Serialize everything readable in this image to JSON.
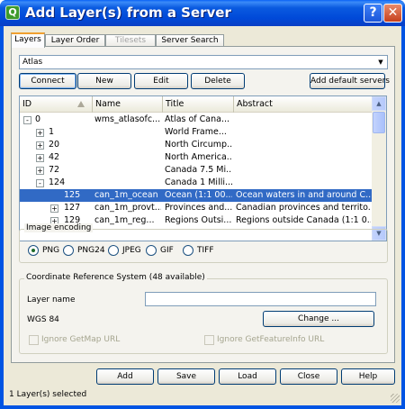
{
  "window": {
    "title": "Add Layer(s) from a Server",
    "help_button": "?",
    "close_button": "✕"
  },
  "tabs": [
    {
      "label": "Layers",
      "active": true
    },
    {
      "label": "Layer Order",
      "active": false
    },
    {
      "label": "Tilesets",
      "active": false,
      "disabled": true
    },
    {
      "label": "Server Search",
      "active": false
    }
  ],
  "server": {
    "selected": "Atlas"
  },
  "buttons": {
    "connect": "Connect",
    "new": "New",
    "edit": "Edit",
    "delete": "Delete",
    "add_default_servers": "Add default servers"
  },
  "layer_table": {
    "columns": [
      "ID",
      "Name",
      "Title",
      "Abstract"
    ],
    "rows": [
      {
        "expander": "-",
        "id": "0",
        "name": "wms_atlasofc...",
        "title": "Atlas of Cana...",
        "abstract": ""
      },
      {
        "expander": "+",
        "id": "1",
        "name": "",
        "title": "World Frame...",
        "abstract": ""
      },
      {
        "expander": "+",
        "id": "20",
        "name": "",
        "title": "North Circump...",
        "abstract": ""
      },
      {
        "expander": "+",
        "id": "42",
        "name": "",
        "title": "North America...",
        "abstract": ""
      },
      {
        "expander": "+",
        "id": "72",
        "name": "",
        "title": "Canada 7.5 Mi...",
        "abstract": ""
      },
      {
        "expander": "-",
        "id": "124",
        "name": "",
        "title": "Canada 1 Milli...",
        "abstract": ""
      },
      {
        "expander": "",
        "id": "125",
        "name": "can_1m_ocean",
        "title": "Ocean (1:1 00...",
        "abstract": "Ocean waters in and around C...",
        "selected": true
      },
      {
        "expander": "+",
        "id": "127",
        "name": "can_1m_provt...",
        "title": "Provinces and...",
        "abstract": "Canadian provinces and territo..."
      },
      {
        "expander": "+",
        "id": "129",
        "name": "can_1m_reg...",
        "title": "Regions Outsi...",
        "abstract": "Regions outside Canada (1:1 0..."
      }
    ]
  },
  "image_encoding": {
    "label": "Image encoding",
    "options": [
      "PNG",
      "PNG24",
      "JPEG",
      "GIF",
      "TIFF"
    ],
    "selected": "PNG"
  },
  "crs": {
    "group_label": "Coordinate Reference System (48 available)",
    "layer_name_label": "Layer name",
    "layer_name_value": "",
    "current_crs": "WGS 84",
    "change_button": "Change ..."
  },
  "options": {
    "ignore_getmap": "Ignore GetMap URL",
    "ignore_getfeatureinfo": "Ignore GetFeatureInfo URL"
  },
  "footer_buttons": {
    "add": "Add",
    "save": "Save",
    "load": "Load",
    "close": "Close",
    "help": "Help"
  },
  "status_text": "1 Layer(s) selected",
  "colors": {
    "selection": "#316ac5",
    "titlebar": "#0054e3",
    "dialog_bg": "#ece9d8"
  }
}
